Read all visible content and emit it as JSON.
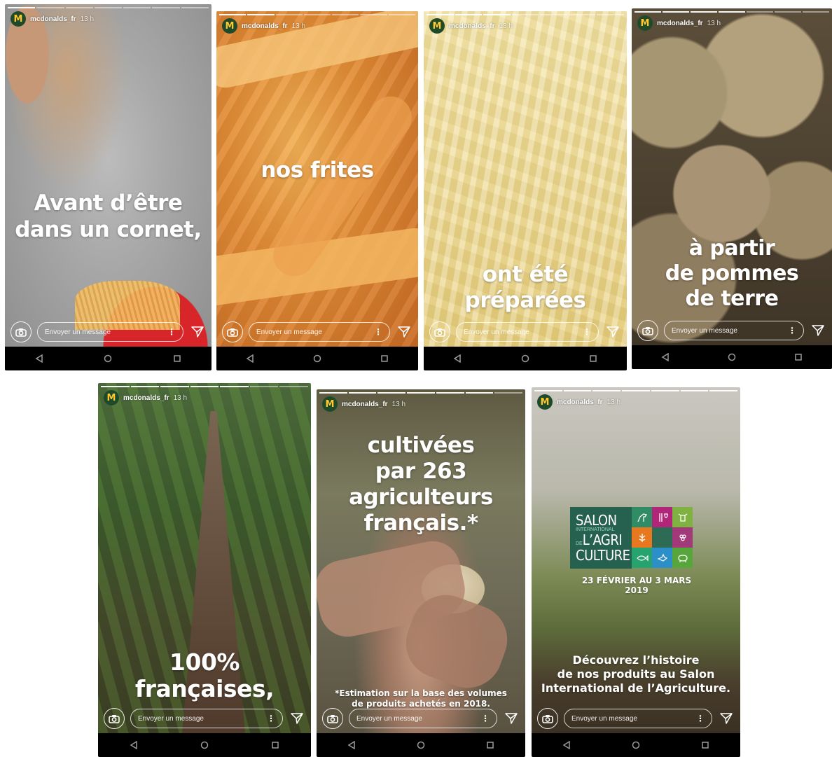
{
  "account": {
    "username": "mcdonalds_fr",
    "time_ago": "13 h",
    "logo_glyph": "M",
    "logo_bg": "#1f4a2a",
    "logo_fg": "#ffc72c"
  },
  "reply": {
    "placeholder": "Envoyer un message",
    "more_glyph": "⋮"
  },
  "stories": [
    {
      "headline": [
        "Avant d’être",
        "dans un cornet,"
      ],
      "progress_done": 1
    },
    {
      "headline": [
        "nos frites"
      ],
      "progress_done": 2
    },
    {
      "headline": [
        "ont été",
        "préparées"
      ],
      "progress_done": 3
    },
    {
      "headline": [
        "à partir",
        "de pommes",
        "de terre"
      ],
      "progress_done": 4
    },
    {
      "headline": [
        "100%",
        "françaises,"
      ],
      "progress_done": 5
    },
    {
      "headline": [
        "cultivées",
        "par 263",
        "agriculteurs",
        "français.*"
      ],
      "footnote": [
        "*Estimation sur la base des volumes",
        "de produits achetés en 2018."
      ],
      "progress_done": 6
    },
    {
      "headline": [
        "Découvrez l’histoire",
        "de nos produits au Salon",
        "International de l’Agriculture."
      ],
      "progress_done": 7,
      "salon": {
        "line1": "SALON",
        "line2": "INTERNATIONAL",
        "line3": "DE",
        "line4": "L’AGRI",
        "line5": "CULTURE",
        "dates": "23 FÉVRIER AU 3 MARS 2019"
      }
    }
  ]
}
